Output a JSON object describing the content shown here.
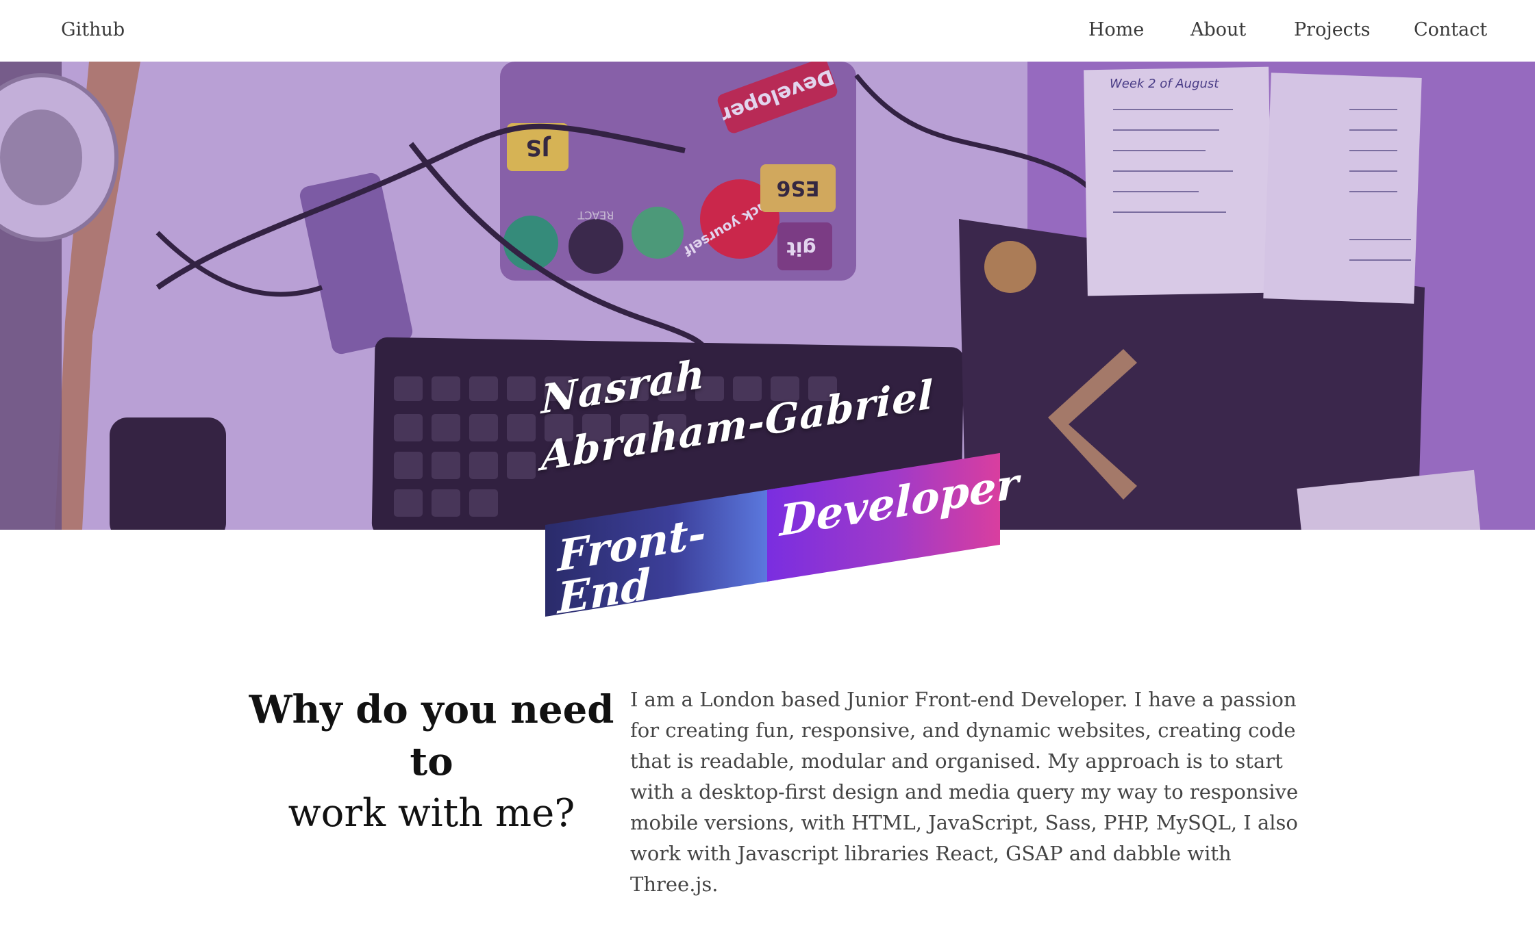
{
  "nav": {
    "brand": "Github",
    "items": [
      "Home",
      "About",
      "Projects",
      "Contact"
    ]
  },
  "hero": {
    "first_name": "Nasrah",
    "last_name": "Abraham-Gabriel",
    "tag_left": "Front-End",
    "tag_right": "Developer",
    "photo_labels": {
      "notebook_title": "Week 2 of August",
      "sticker_developer": "Developer",
      "sticker_es6": "ES6",
      "sticker_js": "JS",
      "sticker_go_hack": "go hack yourself",
      "sticker_react": "REACT",
      "sticker_git": "git"
    }
  },
  "section": {
    "heading_bold": "Why do you need to",
    "heading_regular": "work with me?",
    "paragraph": "I am a London based Junior Front-end Developer. I have a passion for creating fun, responsive, and dynamic websites, creating code that is readable, modular and organised. My approach is to start with a desktop-first design and media query my way to responsive mobile versions, with HTML, JavaScript, Sass, PHP, MySQL, I also work with Javascript libraries React, GSAP and dabble with Three.js."
  },
  "colors": {
    "hero_tint": "#8a5cb4",
    "tag_front_end": "#3c3f9a",
    "tag_developer": "#a03ac8",
    "text": "#333333"
  }
}
